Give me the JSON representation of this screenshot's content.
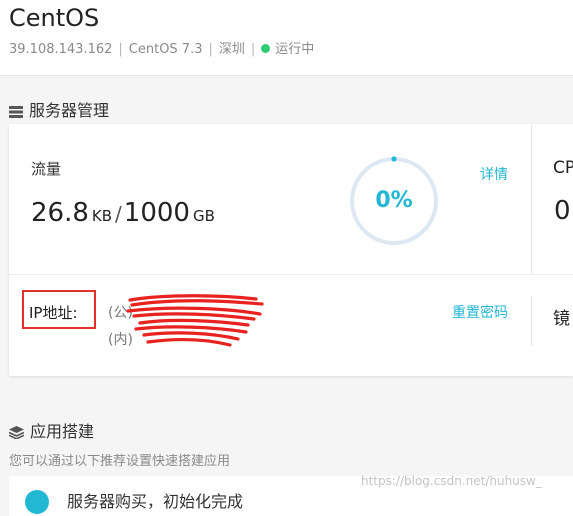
{
  "header": {
    "title": "CentOS",
    "ip": "39.108.143.162",
    "os": "CentOS 7.3",
    "region": "深圳",
    "status": "运行中",
    "separator": "|"
  },
  "server_section": {
    "title": "服务器管理",
    "traffic": {
      "label": "流量",
      "used": "26.8",
      "used_unit": "KB",
      "slash": "/",
      "total": "1000",
      "total_unit": "GB",
      "percent": "0%",
      "details_link": "详情"
    },
    "cut_off_right_1": "CP",
    "cut_off_right_2": "0",
    "ip": {
      "label": "IP地址:",
      "public_prefix": "(公)",
      "private_prefix": "(内)",
      "reset_link": "重置密码"
    },
    "cut_off_right_3": "镜"
  },
  "app_section": {
    "title": "应用搭建",
    "subtitle": "您可以通过以下推荐设置快速搭建应用",
    "step1": "服务器购买，初始化完成"
  },
  "watermark": "https://blog.csdn.net/huhusw_",
  "colors": {
    "accent": "#22b7d3",
    "running": "#2ecc71",
    "highlight_box": "#e0322a",
    "redaction": "#e8221f"
  }
}
